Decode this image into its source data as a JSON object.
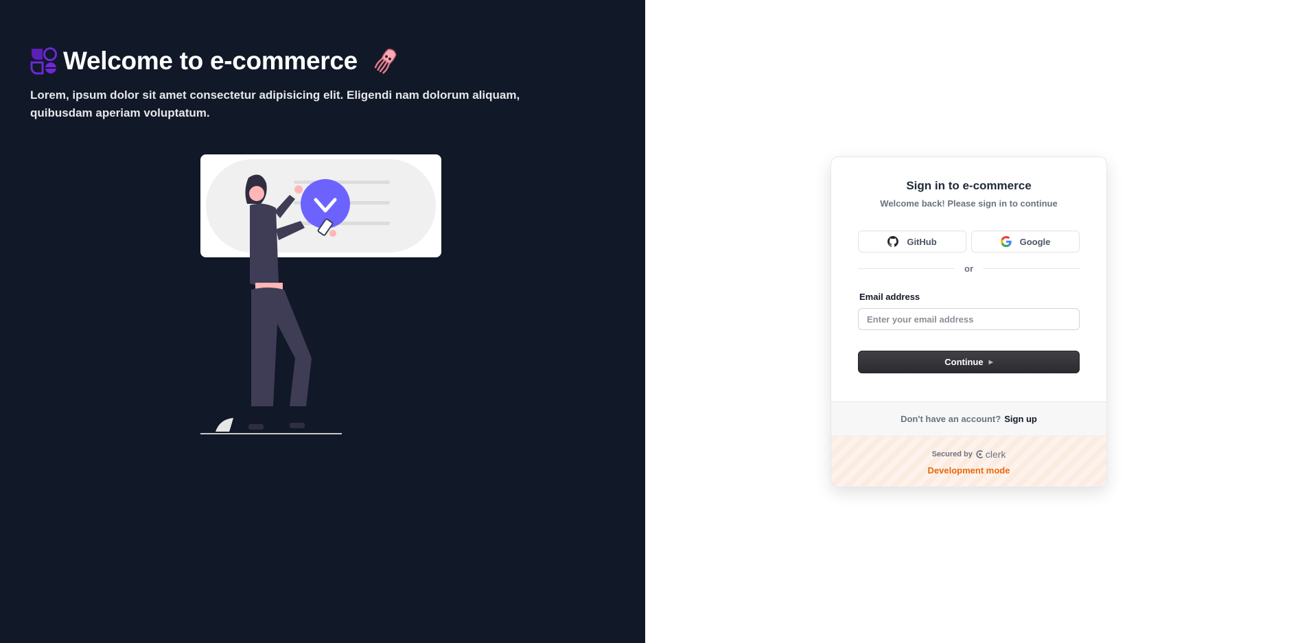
{
  "hero": {
    "title": "Welcome to e-commerce",
    "description": "Lorem, ipsum dolor sit amet consectetur adipisicing elit. Eligendi nam dolorum aliquam, quibusdam aperiam voluptatum."
  },
  "signin": {
    "title": "Sign in to e-commerce",
    "subtitle": "Welcome back! Please sign in to continue",
    "github_label": "GitHub",
    "google_label": "Google",
    "divider_text": "or",
    "email_label": "Email address",
    "email_placeholder": "Enter your email address",
    "email_value": "",
    "continue_label": "Continue",
    "footer_question": "Don't have an account?",
    "signup_link": "Sign up",
    "secured_by": "Secured by",
    "clerk_brand": "clerk",
    "dev_mode": "Development mode"
  },
  "colors": {
    "left_bg": "#111827",
    "accent_purple": "#6c63ff",
    "dev_mode_orange": "#e8690b"
  },
  "icons": [
    "app-logo-icon",
    "squid-emoji-icon",
    "github-icon",
    "google-icon",
    "arrow-right-icon",
    "clerk-logo-icon"
  ]
}
